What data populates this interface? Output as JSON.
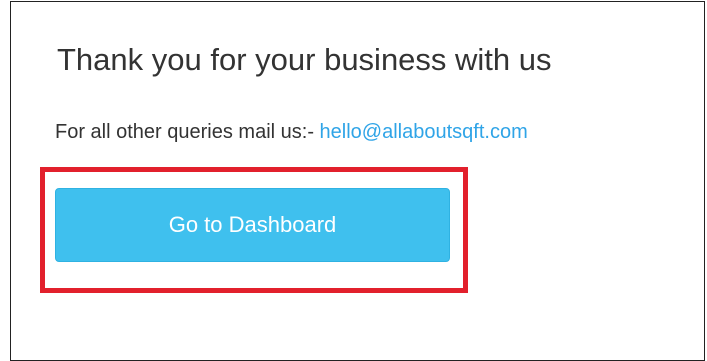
{
  "message": {
    "title": "Thank you for your business with us",
    "queries_prefix": "For all other queries mail us:-",
    "email": "hello@allaboutsqft.com"
  },
  "actions": {
    "dashboard_label": "Go to Dashboard"
  },
  "colors": {
    "link": "#2fa4e7",
    "button": "#3fc0ee",
    "highlight": "#e2202c"
  }
}
